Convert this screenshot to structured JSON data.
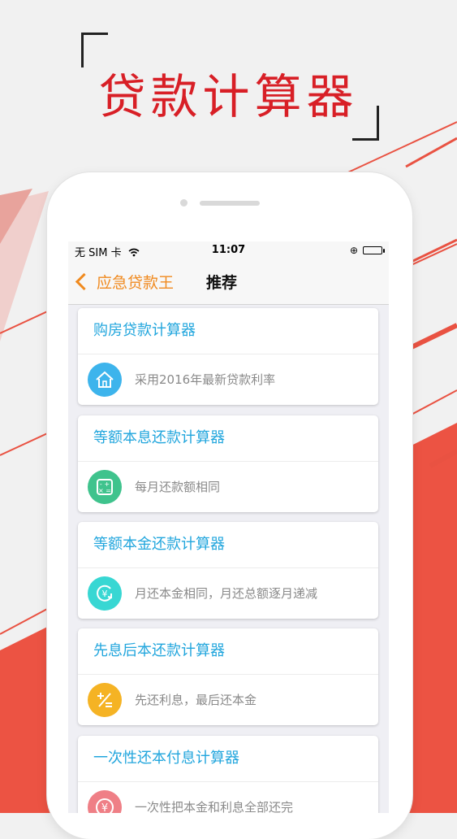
{
  "hero": {
    "title": "贷款计算器"
  },
  "status": {
    "carrier": "无 SIM 卡",
    "time": "11:07",
    "battery_level": 1.0
  },
  "nav": {
    "back_label": "应急贷款王",
    "title": "推荐"
  },
  "cards": [
    {
      "title": "购房贷款计算器",
      "desc": "采用2016年最新贷款利率",
      "icon": "house-icon",
      "color": "#3db4ec"
    },
    {
      "title": "等额本息还款计算器",
      "desc": "每月还款额相同",
      "icon": "calculator-icon",
      "color": "#3fc38d"
    },
    {
      "title": "等额本金还款计算器",
      "desc": "月还本金相同，月还总额逐月递减",
      "icon": "yen-cycle-icon",
      "color": "#38d7d3"
    },
    {
      "title": "先息后本还款计算器",
      "desc": "先还利息，最后还本金",
      "icon": "plus-minus-icon",
      "color": "#f5b324"
    },
    {
      "title": "一次性还本付息计算器",
      "desc": "一次性把本金和利息全部还完",
      "icon": "yen-icon",
      "color": "#ef7f86"
    }
  ],
  "colors": {
    "accent": "#f08a1f",
    "title_blue": "#22a6dd",
    "brand_red": "#d81f26"
  }
}
